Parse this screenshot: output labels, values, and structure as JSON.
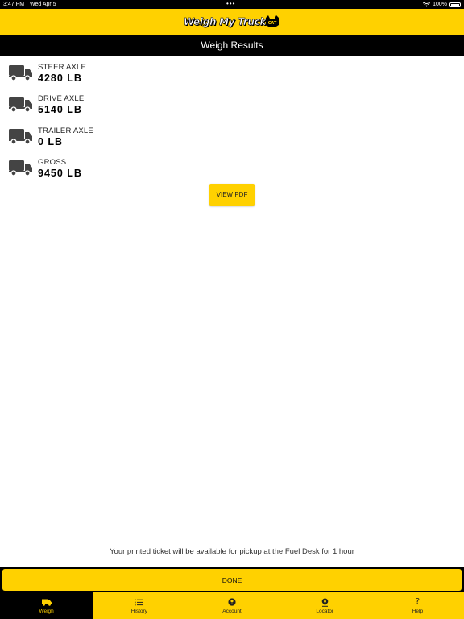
{
  "status_bar": {
    "time": "3:47 PM",
    "date": "Wed Apr 5",
    "battery": "100%"
  },
  "header": {
    "logo_text": "Weigh My Truck",
    "logo_badge": "CAT"
  },
  "page_title": "Weigh Results",
  "results": [
    {
      "label": "STEER AXLE",
      "value": "4280 LB",
      "icon": "truck-icon"
    },
    {
      "label": "DRIVE AXLE",
      "value": "5140 LB",
      "icon": "truck-icon"
    },
    {
      "label": "TRAILER AXLE",
      "value": "0 LB",
      "icon": "truck-icon"
    },
    {
      "label": "GROSS",
      "value": "9450 LB",
      "icon": "truck-icon"
    }
  ],
  "view_pdf_label": "VIEW PDF",
  "notice": "Your printed ticket will be available for pickup at the Fuel Desk for 1 hour",
  "done_label": "DONE",
  "tabs": [
    {
      "label": "Weigh",
      "icon": "truck-icon",
      "active": true
    },
    {
      "label": "History",
      "icon": "list-icon",
      "active": false
    },
    {
      "label": "Account",
      "icon": "user-icon",
      "active": false
    },
    {
      "label": "Locator",
      "icon": "location-pin-icon",
      "active": false
    },
    {
      "label": "Help",
      "icon": "question-icon",
      "active": false
    }
  ],
  "colors": {
    "brand_yellow": "#FFD100",
    "black": "#000000",
    "icon_gray": "#444444"
  }
}
